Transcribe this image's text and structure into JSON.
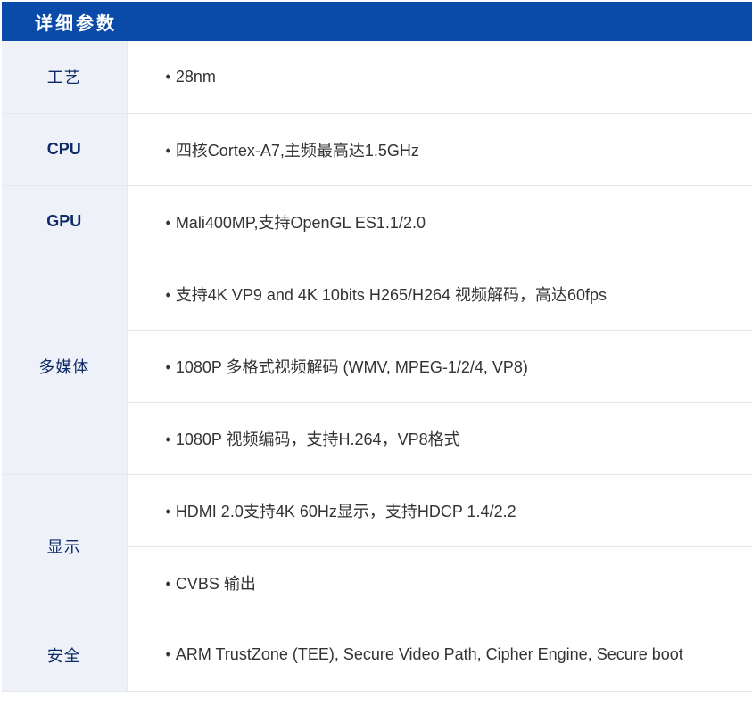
{
  "header": {
    "title": "详细参数"
  },
  "rows": [
    {
      "label": "工艺",
      "values": [
        "28nm"
      ]
    },
    {
      "label": "CPU",
      "values": [
        "四核Cortex-A7,主频最高达1.5GHz"
      ]
    },
    {
      "label": "GPU",
      "values": [
        "Mali400MP,支持OpenGL ES1.1/2.0"
      ]
    },
    {
      "label": "多媒体",
      "values": [
        "支持4K VP9 and 4K 10bits H265/H264 视频解码，高达60fps",
        "1080P 多格式视频解码 (WMV, MPEG-1/2/4, VP8)",
        "1080P 视频编码，支持H.264，VP8格式"
      ]
    },
    {
      "label": "显示",
      "values": [
        "HDMI 2.0支持4K 60Hz显示，支持HDCP 1.4/2.2",
        "CVBS 输出"
      ]
    },
    {
      "label": "安全",
      "values": [
        "ARM TrustZone (TEE), Secure Video Path, Cipher Engine, Secure boot"
      ]
    }
  ],
  "bullet_glyph": "•"
}
